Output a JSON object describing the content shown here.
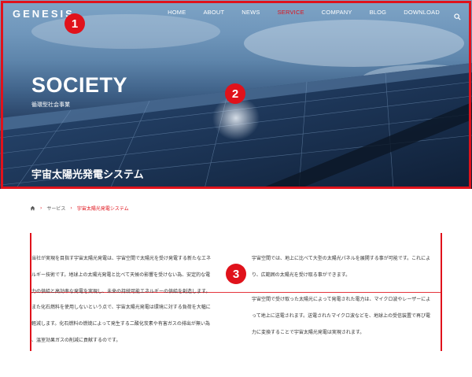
{
  "header": {
    "logo": "GENESIS",
    "nav": [
      "HOME",
      "ABOUT",
      "NEWS",
      "SERVICE",
      "COMPANY",
      "BLOG",
      "DOWNLOAD"
    ],
    "active_nav": "SERVICE",
    "search_icon": "search-icon"
  },
  "hero": {
    "title": "SOCIETY",
    "subtitle": "循環型社会事業",
    "caption": "宇宙太陽光発電システム"
  },
  "breadcrumb": {
    "home_icon": "home-icon",
    "items": [
      "サービス",
      "宇宙太陽光発電システム"
    ]
  },
  "content": {
    "left_top": [
      "当社が実現を目指す宇宙太陽光発電は、宇宙空間で太陽光を受け発電する新たなエネ",
      "ルギー技術です。地球上の太陽光発電と比べて天候の影響を受けない為、安定的な電",
      "力の供給と高効率な発電を実現し、未来の持続可能エネルギーの供給を創造します。"
    ],
    "left_bottom": [
      "また化石燃料を使用しないという点で、宇宙太陽光発電は環境に対する負荷を大幅に",
      "軽減します。化石燃料の燃焼によって発生する二酸化炭素や有害ガスの排出が無い為",
      "、温室効果ガスの削減に貢献するのです。"
    ],
    "right_top": [
      "宇宙空間では、地上に比べて大型の太陽光パネルを展開する事が可能です。これによ",
      "り、広範囲の太陽光を受け取る事ができます。"
    ],
    "right_bottom": [
      "宇宙空間で受け取った太陽光によって発電された電力は、マイクロ波やレーザーによ",
      "って地上に送電されます。送電されたマイクロ波などを、地球上の受信装置で再び電",
      "力に変換することで宇宙太陽光発電は実現されます。"
    ]
  },
  "annotations": [
    "1",
    "2",
    "3"
  ],
  "colors": {
    "accent": "#e0121b"
  }
}
